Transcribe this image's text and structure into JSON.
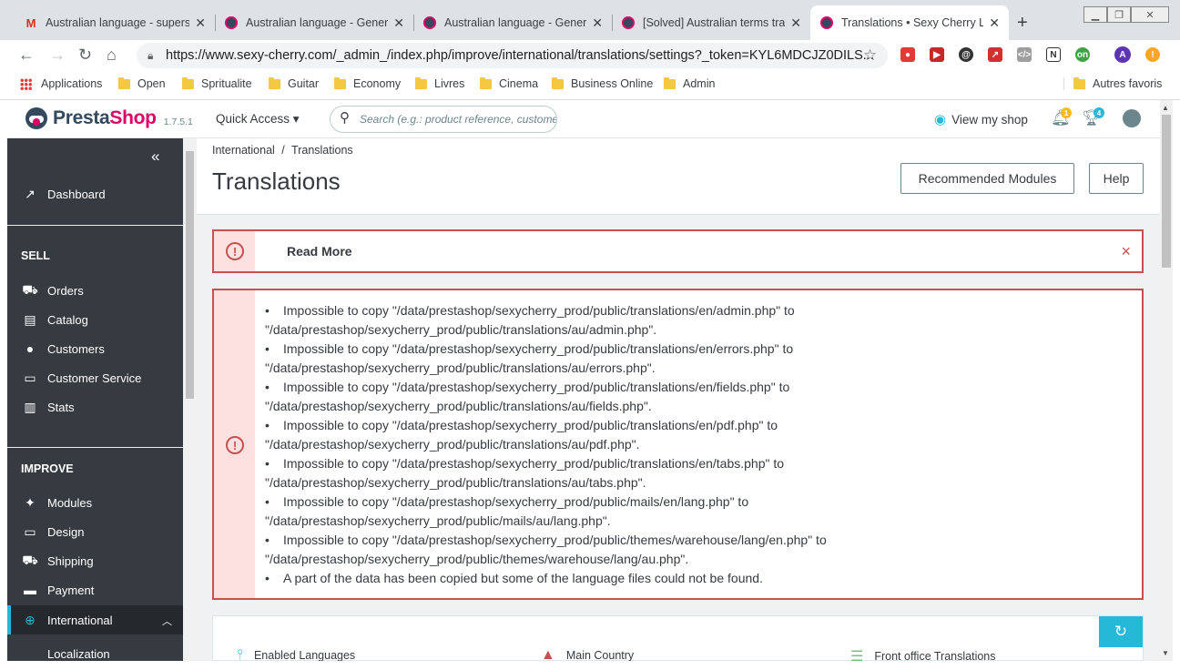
{
  "browser": {
    "tabs": [
      {
        "title": "Australian language - supersi",
        "icon": "gmail-icon",
        "active": false
      },
      {
        "title": "Australian language - Genera",
        "icon": "prestashop-icon",
        "active": false
      },
      {
        "title": "Australian language - Genera",
        "icon": "prestashop-icon",
        "active": false
      },
      {
        "title": "[Solved] Australian terms tran",
        "icon": "prestashop-icon",
        "active": false
      },
      {
        "title": "Translations • Sexy Cherry Lin",
        "icon": "prestashop-icon",
        "active": true
      }
    ],
    "url": "https://www.sexy-cherry.com/_admin_/index.php/improve/international/translations/settings?_token=KYL6MDCJZ0DILS...",
    "bookmarks": [
      "Applications",
      "Open",
      "Spritualite",
      "Guitar",
      "Economy",
      "Livres",
      "Cinema",
      "Business Online",
      "Admin"
    ],
    "other_bookmarks": "Autres favoris",
    "profile_letter": "A"
  },
  "header": {
    "brand_presta": "Presta",
    "brand_shop": "Shop",
    "version": "1.7.5.1",
    "quick_access": "Quick Access ▾",
    "search_placeholder": "Search (e.g.: product reference, customer name…)",
    "view_shop": "View my shop",
    "notif_count": "1",
    "orders_count": "4"
  },
  "sidebar": {
    "dashboard": "Dashboard",
    "sell_title": "SELL",
    "sell_items": [
      "Orders",
      "Catalog",
      "Customers",
      "Customer Service",
      "Stats"
    ],
    "improve_title": "IMPROVE",
    "improve_items": [
      "Modules",
      "Design",
      "Shipping",
      "Payment"
    ],
    "international": "International",
    "localization": "Localization"
  },
  "toolbar": {
    "breadcrumb_parent": "International",
    "breadcrumb_sep": "/",
    "breadcrumb_current": "Translations",
    "title": "Translations",
    "recommended_button": "Recommended Modules",
    "help_button": "Help"
  },
  "alerts": {
    "read_more": "Read More",
    "close_glyph": "×",
    "errors": [
      "Impossible to copy \"/data/prestashop/sexycherry_prod/public/translations/en/admin.php\" to",
      "\"/data/prestashop/sexycherry_prod/public/translations/au/admin.php\".",
      "Impossible to copy \"/data/prestashop/sexycherry_prod/public/translations/en/errors.php\" to",
      "\"/data/prestashop/sexycherry_prod/public/translations/au/errors.php\".",
      "Impossible to copy \"/data/prestashop/sexycherry_prod/public/translations/en/fields.php\" to",
      "\"/data/prestashop/sexycherry_prod/public/translations/au/fields.php\".",
      "Impossible to copy \"/data/prestashop/sexycherry_prod/public/translations/en/pdf.php\" to",
      "\"/data/prestashop/sexycherry_prod/public/translations/au/pdf.php\".",
      "Impossible to copy \"/data/prestashop/sexycherry_prod/public/translations/en/tabs.php\" to",
      "\"/data/prestashop/sexycherry_prod/public/translations/au/tabs.php\".",
      "Impossible to copy \"/data/prestashop/sexycherry_prod/public/mails/en/lang.php\" to",
      "\"/data/prestashop/sexycherry_prod/public/mails/au/lang.php\".",
      "Impossible to copy \"/data/prestashop/sexycherry_prod/public/themes/warehouse/lang/en.php\" to",
      "\"/data/prestashop/sexycherry_prod/public/themes/warehouse/lang/au.php\".",
      "A part of the data has been copied but some of the language files could not be found."
    ]
  },
  "stats": {
    "enabled_languages": "Enabled Languages",
    "main_country": "Main Country",
    "front_office_translations": "Front office Translations"
  },
  "colors": {
    "accent": "#25b9d7",
    "error": "#c75050",
    "sidebar": "#363a41",
    "brand_pink": "#df0067"
  }
}
